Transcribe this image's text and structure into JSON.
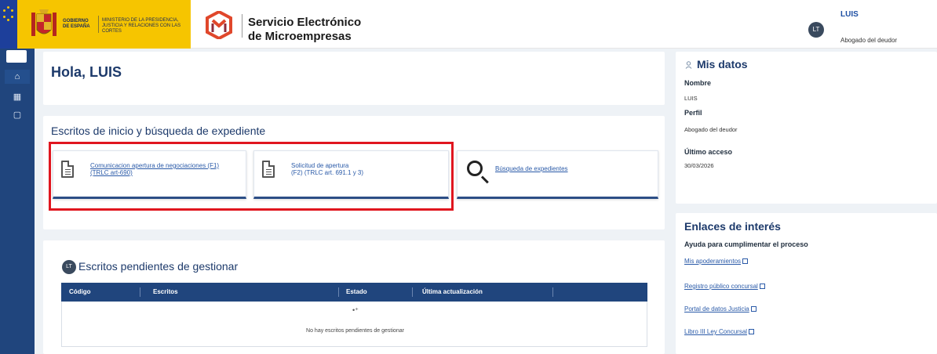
{
  "header": {
    "gobierno_label": "GOBIERNO DE ESPAÑA",
    "ministerio_label": "MINISTERIO DE LA PRESIDENCIA, JUSTICIA Y RELACIONES CON LAS CORTES",
    "app_title_line1": "Servicio Electrónico",
    "app_title_line2": "de Microempresas",
    "user": {
      "initials": "LT",
      "name": "LUIS",
      "role": "Abogado del deudor"
    }
  },
  "sidebar": {
    "items": [
      {
        "icon": "home-icon",
        "glyph": "⌂"
      },
      {
        "icon": "calculator-icon",
        "glyph": "▦"
      },
      {
        "icon": "document-icon",
        "glyph": "▢"
      }
    ]
  },
  "main": {
    "greeting": "Hola, LUIS",
    "section_title": "Escritos de inicio y búsqueda de expediente",
    "tiles": [
      {
        "line1": "Comunicacion apertura de negociaciones (F1)",
        "line2": "(TRLC art-690)"
      },
      {
        "line1": "Solicitud de apertura",
        "line2": "(F2) (TRLC art. 691.1 y 3)"
      },
      {
        "line1": "Búsqueda de expedientes"
      }
    ],
    "pending": {
      "avatar": "LT",
      "title": "Escritos pendientes de gestionar",
      "columns": [
        "Código",
        "Escritos",
        "Estado",
        "Última actualización"
      ],
      "empty_message": "No hay escritos pendientes de gestionar",
      "empty_icon": "•⁺"
    }
  },
  "mis_datos": {
    "title": "Mis datos",
    "nombre_label": "Nombre",
    "nombre_value": "LUIS",
    "perfil_label": "Perfil",
    "perfil_value": "Abogado del deudor",
    "acceso_label": "Último acceso",
    "acceso_value": "30/03/2026"
  },
  "enlaces": {
    "title": "Enlaces de interés",
    "subtitle": "Ayuda para cumplimentar el proceso",
    "links": [
      "Mis apoderamientos",
      "Registro público concursal",
      "Portal de datos Justicia",
      "Libro III Ley Concursal"
    ]
  },
  "colors": {
    "primary": "#20457d",
    "gob_yellow": "#f6c500",
    "highlight": "#e0161f",
    "link": "#2a5aa8"
  }
}
